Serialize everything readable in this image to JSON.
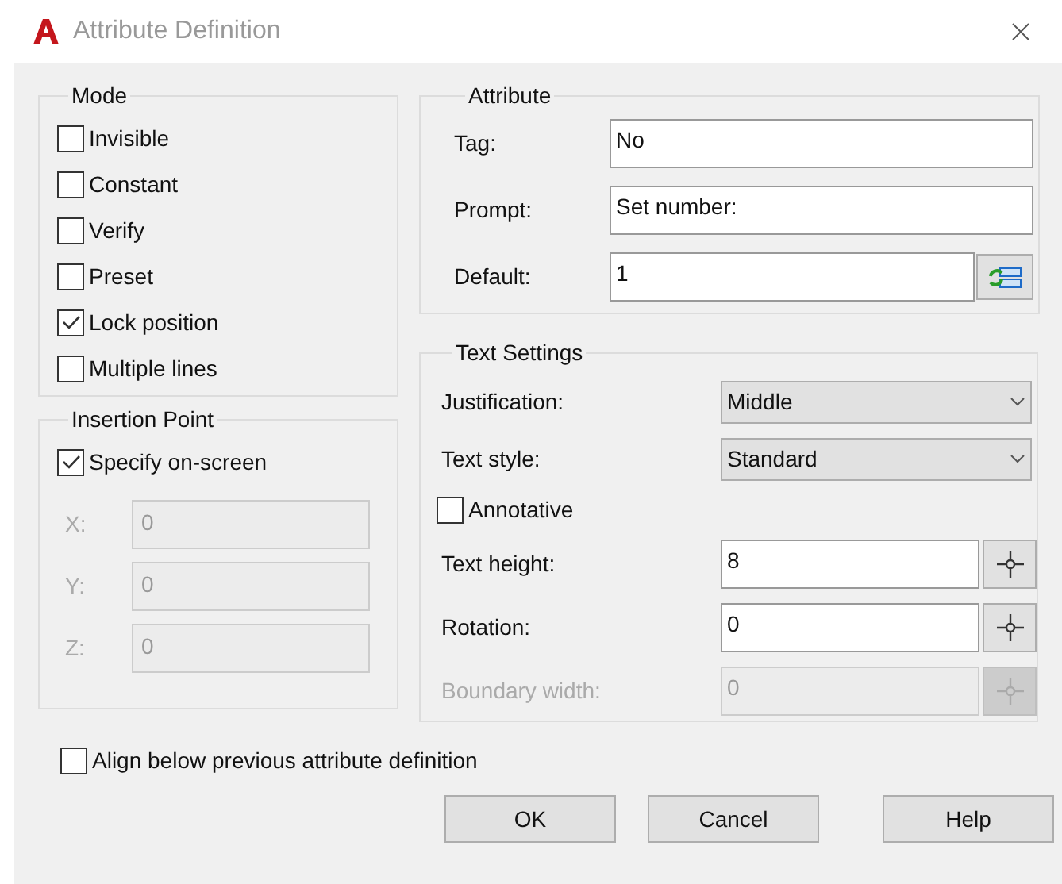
{
  "window": {
    "title": "Attribute Definition"
  },
  "mode": {
    "title": "Mode",
    "options": [
      {
        "label": "Invisible",
        "checked": false
      },
      {
        "label": "Constant",
        "checked": false
      },
      {
        "label": "Verify",
        "checked": false
      },
      {
        "label": "Preset",
        "checked": false
      },
      {
        "label": "Lock position",
        "checked": true
      },
      {
        "label": "Multiple lines",
        "checked": false
      }
    ]
  },
  "insertion_point": {
    "title": "Insertion Point",
    "specify": {
      "label": "Specify on-screen",
      "checked": true
    },
    "coords": [
      {
        "label": "X:",
        "value": "0",
        "disabled": true
      },
      {
        "label": "Y:",
        "value": "0",
        "disabled": true
      },
      {
        "label": "Z:",
        "value": "0",
        "disabled": true
      }
    ]
  },
  "attribute": {
    "title": "Attribute",
    "fields": [
      {
        "label": "Tag:",
        "value": "No",
        "kind": "text"
      },
      {
        "label": "Prompt:",
        "value": "Set number:",
        "kind": "text"
      },
      {
        "label": "Default:",
        "value": "1",
        "kind": "field-button"
      }
    ]
  },
  "text_settings": {
    "title": "Text Settings",
    "rows": [
      {
        "kind": "select",
        "label": "Justification:",
        "value": "Middle"
      },
      {
        "kind": "select",
        "label": "Text style:",
        "value": "Standard"
      },
      {
        "kind": "checkbox",
        "label": "Annotative",
        "checked": false
      },
      {
        "kind": "pick",
        "label": "Text height:",
        "value": "8",
        "disabled": false
      },
      {
        "kind": "pick",
        "label": "Rotation:",
        "value": "0",
        "disabled": false
      },
      {
        "kind": "pick",
        "label": "Boundary width:",
        "value": "0",
        "disabled": true
      }
    ]
  },
  "align": {
    "label": "Align below previous attribute definition",
    "checked": false
  },
  "buttons": [
    "OK",
    "Cancel",
    "Help"
  ]
}
